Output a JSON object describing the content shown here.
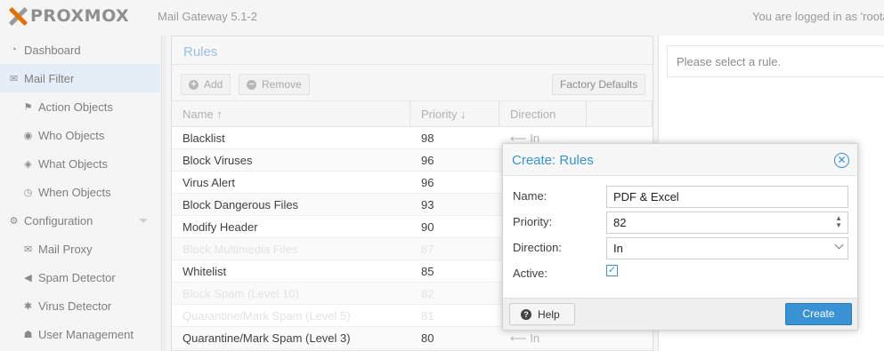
{
  "header": {
    "logo_text": "PROXMOX",
    "product": "Mail Gateway 5.1-2",
    "login_text": "You are logged in as 'roota"
  },
  "nav": {
    "items": [
      {
        "label": "Dashboard",
        "icon": "dashboard-icon",
        "level": 1,
        "selected": false
      },
      {
        "label": "Mail Filter",
        "icon": "envelope-icon",
        "level": 1,
        "selected": true
      },
      {
        "label": "Action Objects",
        "icon": "flag-icon",
        "level": 2,
        "selected": false
      },
      {
        "label": "Who Objects",
        "icon": "user-circle-icon",
        "level": 2,
        "selected": false
      },
      {
        "label": "What Objects",
        "icon": "cube-icon",
        "level": 2,
        "selected": false
      },
      {
        "label": "When Objects",
        "icon": "clock-icon",
        "level": 2,
        "selected": false
      },
      {
        "label": "Configuration",
        "icon": "gears-icon",
        "level": 1,
        "selected": false
      },
      {
        "label": "Mail Proxy",
        "icon": "envelope-o-icon",
        "level": 2,
        "selected": false
      },
      {
        "label": "Spam Detector",
        "icon": "bullhorn-icon",
        "level": 2,
        "selected": false
      },
      {
        "label": "Virus Detector",
        "icon": "bug-icon",
        "level": 2,
        "selected": false
      },
      {
        "label": "User Management",
        "icon": "users-icon",
        "level": 2,
        "selected": false
      }
    ]
  },
  "rules": {
    "title": "Rules",
    "add_label": "Add",
    "remove_label": "Remove",
    "factory_label": "Factory Defaults",
    "columns": {
      "name": "Name ↑",
      "priority": "Priority ↓",
      "direction": "Direction"
    },
    "rows": [
      {
        "name": "Blacklist",
        "priority": "98",
        "direction": "⟵ In",
        "disabled": false
      },
      {
        "name": "Block Viruses",
        "priority": "96",
        "direction": "",
        "disabled": false
      },
      {
        "name": "Virus Alert",
        "priority": "96",
        "direction": "",
        "disabled": false
      },
      {
        "name": "Block Dangerous Files",
        "priority": "93",
        "direction": "",
        "disabled": false
      },
      {
        "name": "Modify Header",
        "priority": "90",
        "direction": "",
        "disabled": false
      },
      {
        "name": "Block Multimedia Files",
        "priority": "87",
        "direction": "",
        "disabled": true
      },
      {
        "name": "Whitelist",
        "priority": "85",
        "direction": "",
        "disabled": false
      },
      {
        "name": "Block Spam (Level 10)",
        "priority": "82",
        "direction": "",
        "disabled": true
      },
      {
        "name": "Quarantine/Mark Spam (Level 5)",
        "priority": "81",
        "direction": "",
        "disabled": true
      },
      {
        "name": "Quarantine/Mark Spam (Level 3)",
        "priority": "80",
        "direction": "⟵ In",
        "disabled": false
      }
    ]
  },
  "info": {
    "message": "Please select a rule."
  },
  "dialog": {
    "title": "Create: Rules",
    "name_label": "Name:",
    "name_value": "PDF & Excel",
    "priority_label": "Priority:",
    "priority_value": "82",
    "direction_label": "Direction:",
    "direction_value": "In",
    "active_label": "Active:",
    "active_checked": true,
    "help_label": "Help",
    "create_label": "Create"
  },
  "colors": {
    "accent": "#3892d3",
    "logo_orange": "#e57000",
    "selected_nav": "#e5eef7"
  }
}
